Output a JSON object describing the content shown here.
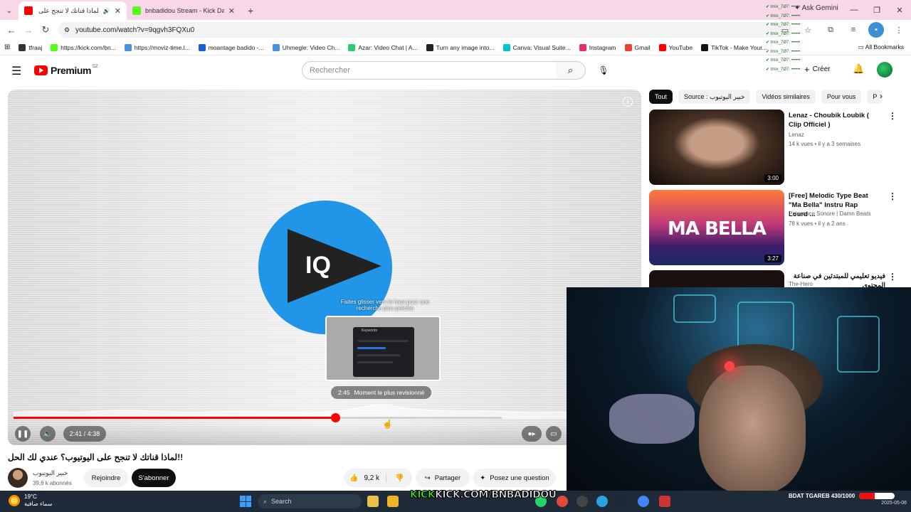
{
  "browser": {
    "tabs": [
      {
        "title": "لماذا قناتك لا تنجح على اليوت",
        "active": true,
        "favicon_color": "#ff0000"
      },
      {
        "title": "bnbadidou Stream - Kick Dashb",
        "active": false,
        "favicon_color": "#53fc18"
      }
    ],
    "ask_gemini": "Ask Gemini",
    "url": "youtube.com/watch?v=9qgvh3FQXu0",
    "bookmarks": [
      {
        "label": "tfraaj",
        "icon_color": "#333"
      },
      {
        "label": "https://kick.com/bn...",
        "icon_color": "#53fc18"
      },
      {
        "label": "https://moviz-time.l...",
        "icon_color": "#4a90e2"
      },
      {
        "label": "moantage badido -...",
        "icon_color": "#1a5fd6"
      },
      {
        "label": "Uhmegle: Video Ch...",
        "icon_color": "#4a90e2"
      },
      {
        "label": "Azar: Video Chat | A...",
        "icon_color": "#2ecc71"
      },
      {
        "label": "Turn any image into...",
        "icon_color": "#222"
      },
      {
        "label": "Canva: Visual Suite...",
        "icon_color": "#00c4cc"
      },
      {
        "label": "Instagram",
        "icon_color": "#e1306c"
      },
      {
        "label": "Gmail",
        "icon_color": "#ea4335"
      },
      {
        "label": "YouTube",
        "icon_color": "#ff0000"
      },
      {
        "label": "TikTok - Make Your...",
        "icon_color": "#111"
      }
    ],
    "all_bookmarks": "All Bookmarks"
  },
  "youtube": {
    "logo_text": "Premium",
    "logo_region": "DZ",
    "search_placeholder": "Rechercher",
    "create_label": "Créer"
  },
  "player": {
    "logo_text": "IQ",
    "drag_hint": "Faites glisser vers le haut pour une recherche plus précise",
    "preview_title": "Keywords",
    "most_replayed_time": "2:45",
    "most_replayed_label": "Moment le plus revisionné",
    "current_time": "2:41",
    "duration": "4:38",
    "time_display": "2:41 / 4:38",
    "progress_fraction": 0.579,
    "buffer_fraction": 0.88
  },
  "video": {
    "title": "!!لماذا قناتك لا تنجح على اليوتيوب؟ عندي لك الحل",
    "channel": "خبير اليوتيوب",
    "subscribers": "39,6 k abonnés",
    "join_label": "Rejoindre",
    "subscribe_label": "S'abonner",
    "likes": "9,2 k",
    "share_label": "Partager",
    "ask_label": "Posez une question"
  },
  "sidebar": {
    "chips": [
      {
        "label": "Tout",
        "active": true
      },
      {
        "label": "Source : خبير اليوتيوب",
        "active": false
      },
      {
        "label": "Vidéos similaires",
        "active": false
      },
      {
        "label": "Pour vous",
        "active": false
      },
      {
        "label": "P",
        "active": false
      }
    ],
    "recommendations": [
      {
        "title": "Lenaz - Choubik Loubik ( Clip Officiel )",
        "channel": "Lenaz",
        "meta": "14 k vues • il y a 3 semaines",
        "duration": "3:00"
      },
      {
        "title": "[Free] Melodic Type Beat \"Ma Bella\" Instru Rap Lourd ...",
        "channel": "Puissance Sonore | Damn Beats",
        "meta": "78 k vues • il y a 2 ans",
        "duration": "3:27",
        "thumb_text": "MA BELLA"
      },
      {
        "title": "فيديو تعليمي للمبتدئين في صناعة المحتوى",
        "channel": "The-Hero",
        "meta": "",
        "duration": ""
      }
    ]
  },
  "overlay": {
    "kick_prefix": "KICK",
    "kick_url": "KICK.COM/BNBADIDOU",
    "goal_label": "BDAT TGAREB 430/1000",
    "goal_fraction": 0.43
  },
  "taskbar": {
    "temperature": "19°C",
    "weather_desc": "سماء صافية",
    "search_placeholder": "Search",
    "clock_time": "",
    "clock_date": "2025-05-06"
  },
  "colors": {
    "accent": "#ff0000",
    "kick_green": "#53fc18",
    "taskbar": "#1f2a38",
    "tabbar": "#f7d7e8"
  }
}
